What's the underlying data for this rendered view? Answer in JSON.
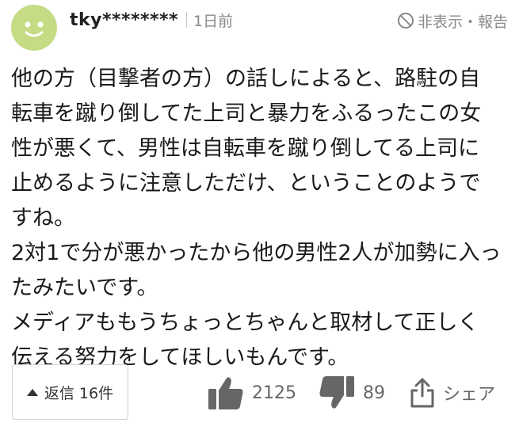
{
  "comment": {
    "username": "tky********",
    "time": "1日前",
    "hide_report": "非表示・報告",
    "lines": [
      "他の方（目撃者の方）の話しによると、路駐の自",
      "転車を蹴り倒してた上司と暴力をふるったこの女",
      "性が悪くて、男性は自転車を蹴り倒してる上司に",
      "止めるように注意しただけ、ということのようで",
      "すね。",
      "2対1で分が悪かったから他の男性2人が加勢に入っ",
      "たみたいです。",
      "メディアももうちょっとちゃんと取材して正しく",
      "伝える努力をしてほしいもんです。"
    ]
  },
  "footer": {
    "reply_label": "返信 16件",
    "like_count": "2125",
    "dislike_count": "89",
    "share_label": "シェア"
  },
  "colors": {
    "avatar": "#c5dc84",
    "icon": "#666666",
    "meta_text": "#8a8a8a"
  },
  "icons": {
    "avatar": "smiley-avatar-icon",
    "hide": "no-entry-icon",
    "reply": "triangle-up-icon",
    "like": "thumbs-up-icon",
    "dislike": "thumbs-down-icon",
    "share": "share-icon"
  }
}
